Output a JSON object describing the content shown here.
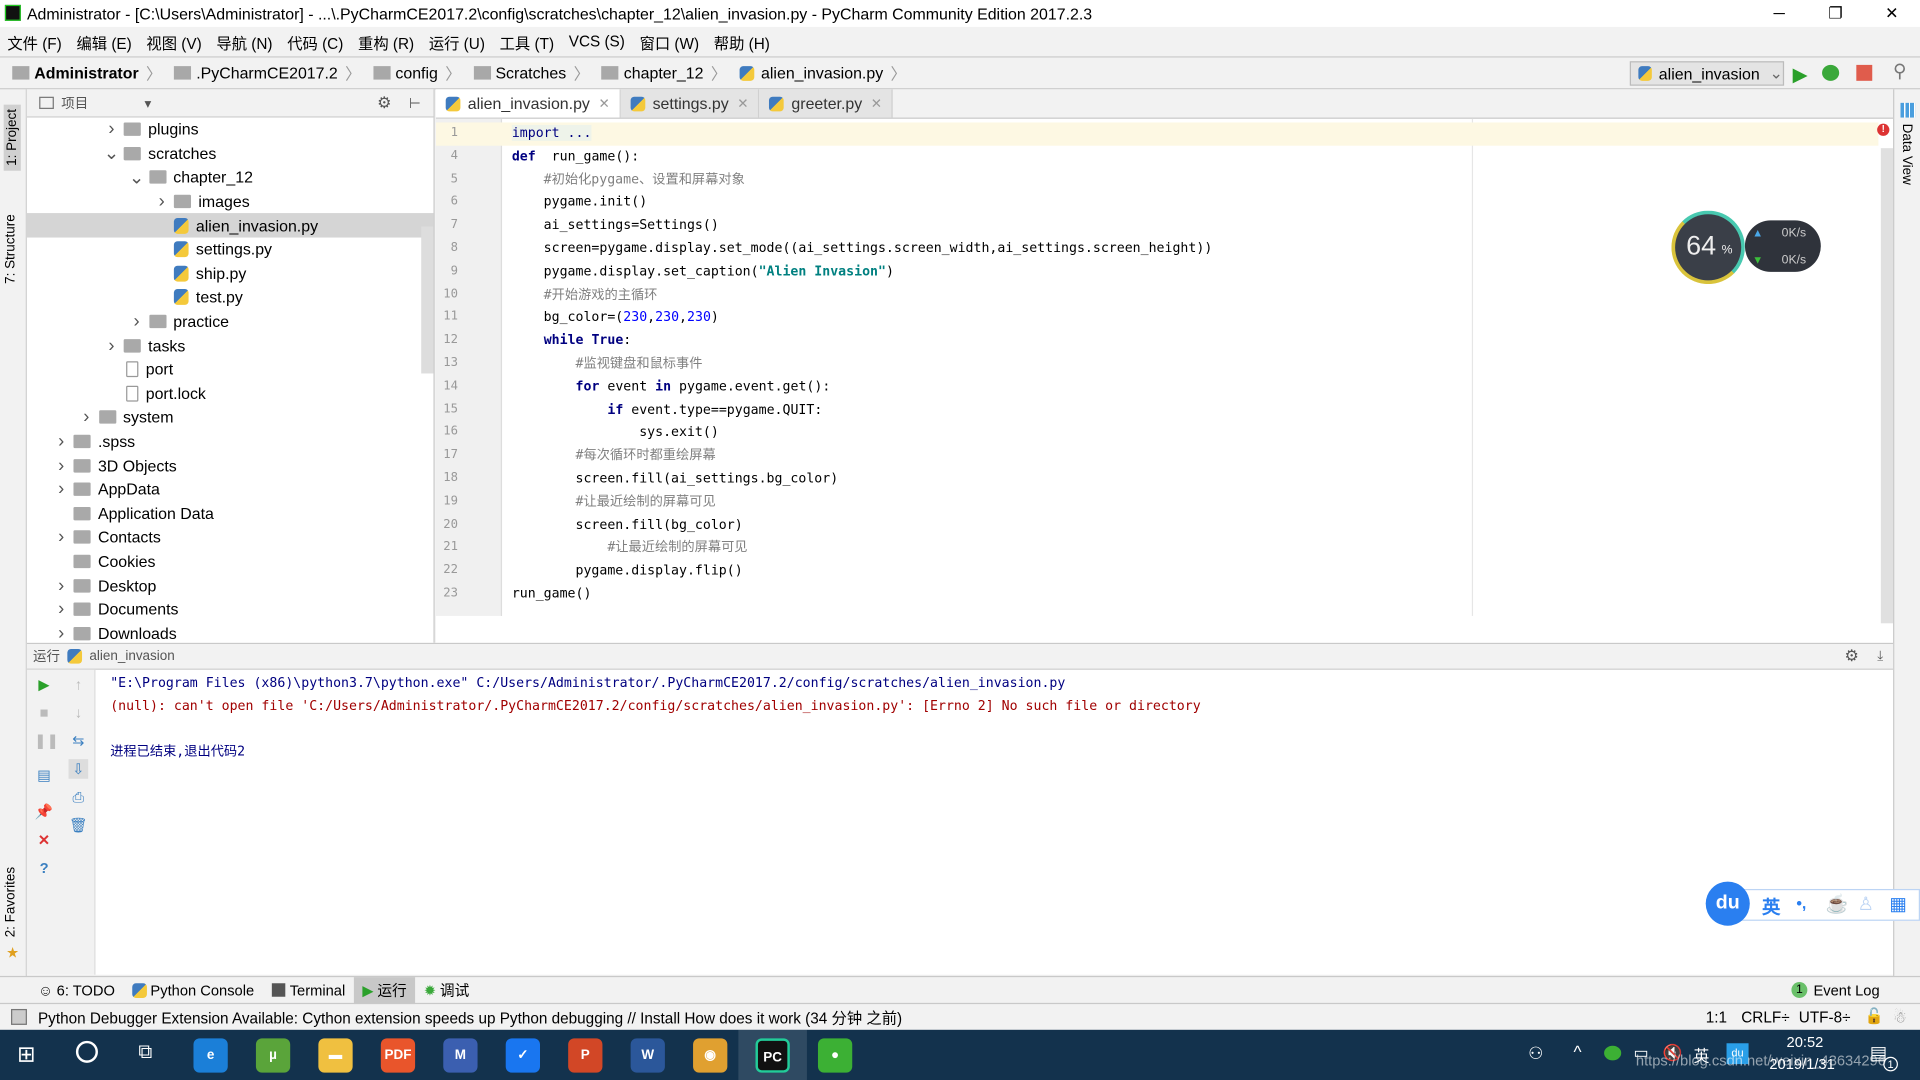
{
  "window": {
    "title": "Administrator - [C:\\Users\\Administrator] - ...\\.PyCharmCE2017.2\\config\\scratches\\chapter_12\\alien_invasion.py - PyCharm Community Edition 2017.2.3",
    "minimize": "─",
    "maximize": "❐",
    "close": "✕"
  },
  "menu": [
    "文件 (F)",
    "编辑 (E)",
    "视图 (V)",
    "导航 (N)",
    "代码 (C)",
    "重构 (R)",
    "运行 (U)",
    "工具 (T)",
    "VCS (S)",
    "窗口 (W)",
    "帮助 (H)"
  ],
  "breadcrumb": [
    "Administrator",
    ".PyCharmCE2017.2",
    "config",
    "Scratches",
    "chapter_12",
    "alien_invasion.py"
  ],
  "run_config": {
    "name": "alien_invasion",
    "run_icon": "run-icon",
    "debug_icon": "debug-icon",
    "stop_icon": "stop-icon",
    "search_icon": "search-icon"
  },
  "left_strip": {
    "project": "1: Project",
    "structure": "7: Structure",
    "favorites": "2: Favorites"
  },
  "right_strip": {
    "data_view": "Data View"
  },
  "project": {
    "header": "项目",
    "items": [
      {
        "label": "plugins",
        "level": 3,
        "arrow": "right",
        "type": "folder"
      },
      {
        "label": "scratches",
        "level": 3,
        "arrow": "down",
        "type": "folder"
      },
      {
        "label": "chapter_12",
        "level": 4,
        "arrow": "down",
        "type": "folder"
      },
      {
        "label": "images",
        "level": 5,
        "arrow": "right",
        "type": "folder"
      },
      {
        "label": "alien_invasion.py",
        "level": 5,
        "arrow": "",
        "type": "py",
        "selected": true
      },
      {
        "label": "settings.py",
        "level": 5,
        "arrow": "",
        "type": "py"
      },
      {
        "label": "ship.py",
        "level": 5,
        "arrow": "",
        "type": "py"
      },
      {
        "label": "test.py",
        "level": 5,
        "arrow": "",
        "type": "py"
      },
      {
        "label": "practice",
        "level": 4,
        "arrow": "right",
        "type": "folder"
      },
      {
        "label": "tasks",
        "level": 3,
        "arrow": "right",
        "type": "folder"
      },
      {
        "label": "port",
        "level": 3,
        "arrow": "",
        "type": "file"
      },
      {
        "label": "port.lock",
        "level": 3,
        "arrow": "",
        "type": "file"
      },
      {
        "label": "system",
        "level": 2,
        "arrow": "right",
        "type": "folder"
      },
      {
        "label": ".spss",
        "level": 1,
        "arrow": "right",
        "type": "folder"
      },
      {
        "label": "3D Objects",
        "level": 1,
        "arrow": "right",
        "type": "folder"
      },
      {
        "label": "AppData",
        "level": 1,
        "arrow": "right",
        "type": "folder"
      },
      {
        "label": "Application Data",
        "level": 1,
        "arrow": "",
        "type": "folder"
      },
      {
        "label": "Contacts",
        "level": 1,
        "arrow": "right",
        "type": "folder"
      },
      {
        "label": "Cookies",
        "level": 1,
        "arrow": "",
        "type": "folder"
      },
      {
        "label": "Desktop",
        "level": 1,
        "arrow": "right",
        "type": "folder"
      },
      {
        "label": "Documents",
        "level": 1,
        "arrow": "right",
        "type": "folder"
      },
      {
        "label": "Downloads",
        "level": 1,
        "arrow": "right",
        "type": "folder"
      }
    ]
  },
  "tabs": [
    {
      "label": "alien_invasion.py",
      "active": true
    },
    {
      "label": "settings.py"
    },
    {
      "label": "greeter.py"
    }
  ],
  "code": [
    {
      "n": "1",
      "cur": true,
      "t": [
        [
          "imp",
          "import ..."
        ]
      ]
    },
    {
      "n": "4",
      "t": [
        [
          "kw",
          "def"
        ],
        [
          "",
          "  run_game():"
        ]
      ]
    },
    {
      "n": "5",
      "t": [
        [
          "cm",
          "    #初始化pygame、设置和屏幕对象"
        ]
      ]
    },
    {
      "n": "6",
      "t": [
        [
          "",
          "    pygame.init()"
        ]
      ]
    },
    {
      "n": "7",
      "t": [
        [
          "",
          "    ai_settings=Settings()"
        ]
      ]
    },
    {
      "n": "8",
      "t": [
        [
          "",
          "    screen=pygame.display.set_mode((ai_settings.screen_width,ai_settings.screen_height))"
        ]
      ]
    },
    {
      "n": "9",
      "t": [
        [
          "",
          "    pygame.display.set_caption("
        ],
        [
          "str",
          "\"Alien Invasion\""
        ],
        [
          "",
          ")"
        ]
      ]
    },
    {
      "n": "10",
      "t": [
        [
          "cm",
          "    #开始游戏的主循环"
        ]
      ]
    },
    {
      "n": "11",
      "t": [
        [
          "",
          "    bg_color=("
        ],
        [
          "num",
          "230"
        ],
        [
          "",
          ","
        ],
        [
          "num",
          "230"
        ],
        [
          "",
          ","
        ],
        [
          "num",
          "230"
        ],
        [
          "",
          ")"
        ]
      ]
    },
    {
      "n": "12",
      "t": [
        [
          "",
          "    "
        ],
        [
          "kw",
          "while True"
        ],
        [
          "",
          ":"
        ]
      ]
    },
    {
      "n": "13",
      "t": [
        [
          "cm",
          "        #监视键盘和鼠标事件"
        ]
      ]
    },
    {
      "n": "14",
      "t": [
        [
          "",
          "        "
        ],
        [
          "kw",
          "for"
        ],
        [
          "",
          " event "
        ],
        [
          "kw",
          "in"
        ],
        [
          "",
          " pygame.event.get():"
        ]
      ]
    },
    {
      "n": "15",
      "t": [
        [
          "",
          "            "
        ],
        [
          "kw",
          "if"
        ],
        [
          "",
          " event.type==pygame.QUIT:"
        ]
      ]
    },
    {
      "n": "16",
      "t": [
        [
          "",
          "                sys.exit()"
        ]
      ]
    },
    {
      "n": "17",
      "t": [
        [
          "cm",
          "        #每次循环时都重绘屏幕"
        ]
      ]
    },
    {
      "n": "18",
      "t": [
        [
          "",
          "        screen.fill(ai_settings.bg_color)"
        ]
      ]
    },
    {
      "n": "19",
      "t": [
        [
          "cm",
          "        #让最近绘制的屏幕可见"
        ]
      ]
    },
    {
      "n": "20",
      "t": [
        [
          "",
          "        screen.fill(bg_color)"
        ]
      ]
    },
    {
      "n": "21",
      "t": [
        [
          "cm",
          "            #让最近绘制的屏幕可见"
        ]
      ]
    },
    {
      "n": "22",
      "t": [
        [
          "",
          "        pygame.display.flip()"
        ]
      ]
    },
    {
      "n": "23",
      "t": [
        [
          "",
          "run_game()"
        ]
      ]
    }
  ],
  "network_widget": {
    "percent": "64",
    "unit": "%",
    "up": "0K/s",
    "down": "0K/s"
  },
  "run_panel": {
    "label": "运行",
    "config": "alien_invasion",
    "lines": [
      {
        "text": "\"E:\\Program Files (x86)\\python3.7\\python.exe\" C:/Users/Administrator/.PyCharmCE2017.2/config/scratches/alien_invasion.py",
        "color": "#000080"
      },
      {
        "text": "(null): can't open file 'C:/Users/Administrator/.PyCharmCE2017.2/config/scratches/alien_invasion.py': [Errno 2] No such file or directory",
        "color": "#a00000"
      },
      {
        "text": "",
        "color": "#000"
      },
      {
        "text": "进程已结束,退出代码2",
        "color": "#000080"
      }
    ]
  },
  "bottom_tabs": [
    "6: TODO",
    "Python Console",
    "Terminal",
    "运行",
    "调试"
  ],
  "event_log": {
    "count": "1",
    "label": "Event Log"
  },
  "status": {
    "message": "Python Debugger Extension Available: Cython extension speeds up Python debugging // Install How does it work (34 分钟 之前)",
    "position": "1:1",
    "line_sep": "CRLF÷",
    "encoding": "UTF-8÷"
  },
  "ime": {
    "lang": "英",
    "punct": "•,"
  },
  "taskbar": {
    "time": "20:52",
    "date": "2019/1/31",
    "tray_lang": "英",
    "notifications": "1",
    "apps": [
      {
        "name": "edge",
        "label": "e",
        "color": "#1b7fd8"
      },
      {
        "name": "utorrent",
        "label": "µ",
        "color": "#5aa43a"
      },
      {
        "name": "explorer",
        "label": "▬",
        "color": "#f0c040"
      },
      {
        "name": "pdf",
        "label": "PDF",
        "color": "#e9552b"
      },
      {
        "name": "mindmap",
        "label": "M",
        "color": "#3b5fb0"
      },
      {
        "name": "security",
        "label": "✓",
        "color": "#1976f0"
      },
      {
        "name": "powerpoint",
        "label": "P",
        "color": "#d24726"
      },
      {
        "name": "word",
        "label": "W",
        "color": "#2b579a"
      },
      {
        "name": "eye",
        "label": "◉",
        "color": "#e0a030"
      },
      {
        "name": "pycharm",
        "label": "PC",
        "color": "#111"
      },
      {
        "name": "wechat",
        "label": "●",
        "color": "#3cb034"
      }
    ]
  },
  "watermark": "https://blog.csdn.net/weixin_43634296"
}
